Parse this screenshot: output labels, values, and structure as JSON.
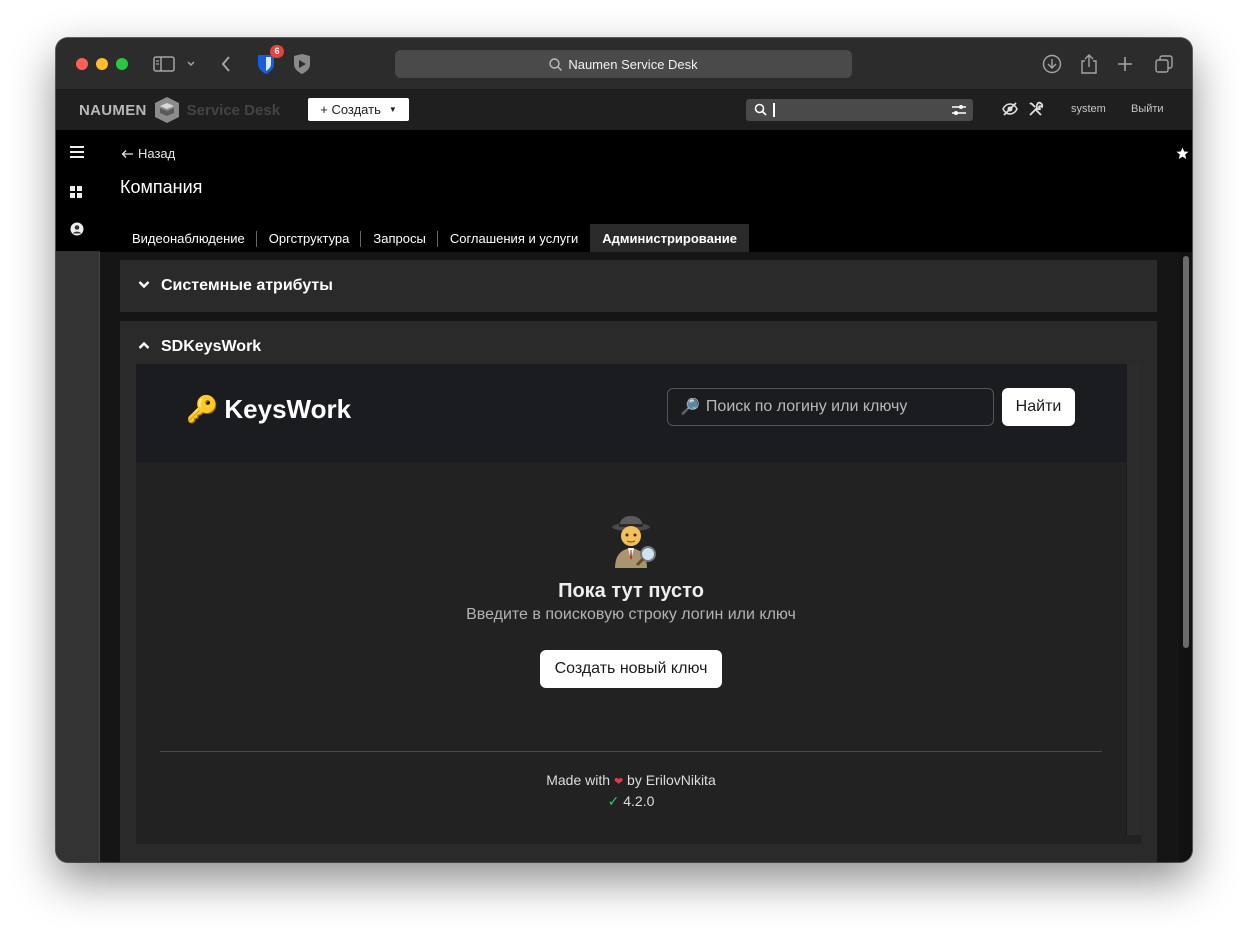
{
  "browser": {
    "url_text": "Naumen Service Desk",
    "bitwarden_badge": "6"
  },
  "app": {
    "logo_left": "NAUMEN",
    "logo_right": "Service Desk",
    "create_label": "+ Создать",
    "search_value": "",
    "user": "system",
    "logout": "Выйти"
  },
  "header": {
    "back_label": "Назад",
    "title": "Компания",
    "tabs": [
      {
        "label": "Видеонаблюдение",
        "active": false
      },
      {
        "label": "Оргструктура",
        "active": false
      },
      {
        "label": "Запросы",
        "active": false
      },
      {
        "label": "Соглашения и услуги",
        "active": false
      },
      {
        "label": "Администрирование",
        "active": true
      }
    ]
  },
  "panels": {
    "system_attrs": "Системные атрибуты",
    "sdkeyswork": "SDKeysWork"
  },
  "keyswork": {
    "logo_emoji": "🔑",
    "logo_text": "KeysWork",
    "search_placeholder": "Поиск по логину или ключу",
    "search_emoji": "🔎",
    "find_label": "Найти",
    "empty_title": "Пока тут пусто",
    "empty_subtitle": "Введите в поисковую строку логин или ключ",
    "create_key_label": "Создать новый ключ",
    "made_with": "Made with",
    "by_author": "by ErilovNikita",
    "version": "4.2.0"
  },
  "colors": {
    "accent_heart": "#e63946",
    "check_green": "#39c26b",
    "header_bg": "#000000"
  }
}
